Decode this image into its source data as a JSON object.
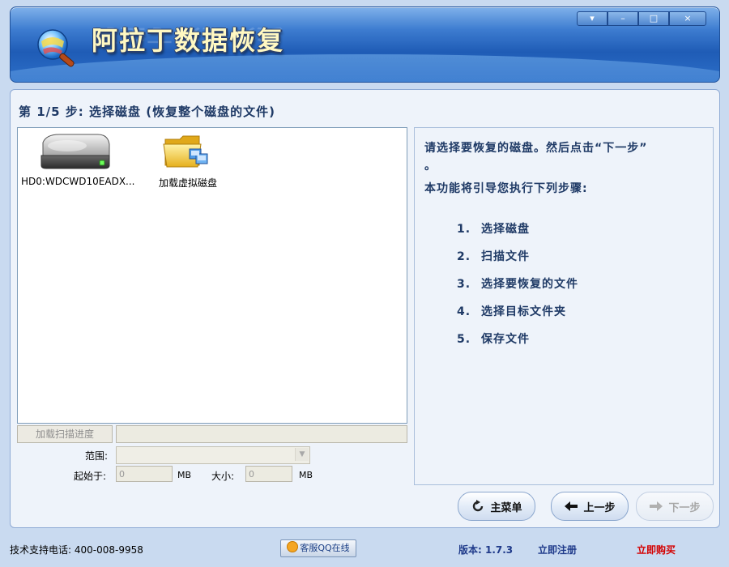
{
  "window": {
    "title": "阿拉丁数据恢复",
    "controls": {
      "menu": "▾",
      "minimize": "–",
      "maximize": "□",
      "close": "×"
    }
  },
  "step": {
    "title": "第 1/5 步: 选择磁盘 (恢复整个磁盘的文件)"
  },
  "drives": [
    {
      "label": "HD0:WDCWD10EADX...",
      "icon": "hard-disk-icon"
    },
    {
      "label": "加载虚拟磁盘",
      "icon": "folder-icon"
    }
  ],
  "info": {
    "line1": "请选择要恢复的磁盘。然后点击“下一步”",
    "line1_tail": "。",
    "line2": "本功能将引导您执行下列步骤:",
    "steps": [
      {
        "num": "1.",
        "text": "选择磁盘"
      },
      {
        "num": "2.",
        "text": "扫描文件"
      },
      {
        "num": "3.",
        "text": "选择要恢复的文件"
      },
      {
        "num": "4.",
        "text": "选择目标文件夹"
      },
      {
        "num": "5.",
        "text": "保存文件"
      }
    ]
  },
  "scan": {
    "load_progress_label": "加载扫描进度",
    "range_label": "范围:",
    "start_label": "起始于:",
    "start_value": "0",
    "size_label": "大小:",
    "size_value": "0",
    "unit": "MB"
  },
  "nav": {
    "main_menu": "主菜单",
    "prev": "上一步",
    "next": "下一步"
  },
  "status": {
    "phone": "技术支持电话: 400-008-9958",
    "qq": "客服QQ在线",
    "version": "版本: 1.7.3",
    "register": "立即注册",
    "buy": "立即购买"
  },
  "colors": {
    "banner": "#2d6fc8",
    "panel": "#eef3fa",
    "text": "#1f3a66",
    "buy": "#d40000"
  }
}
